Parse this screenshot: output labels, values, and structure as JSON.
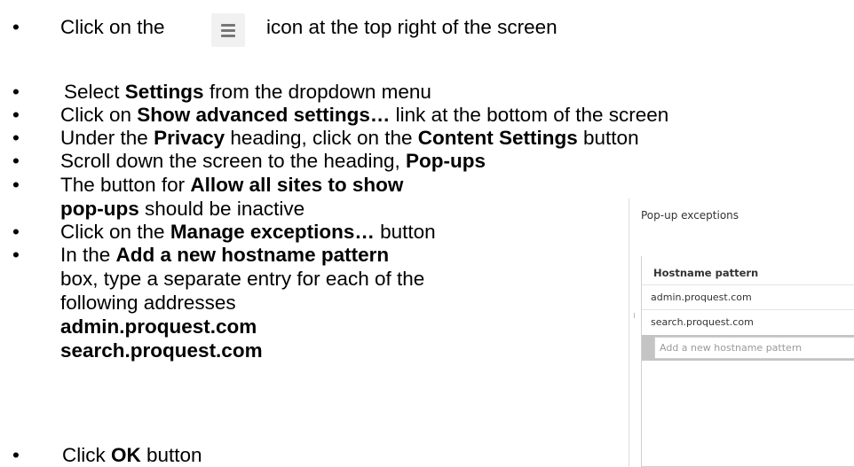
{
  "instructions": {
    "bullet": "•",
    "step1": {
      "before": "Click on the",
      "icon": "hamburger-menu-icon",
      "after": "icon at the top right of the screen"
    },
    "step2": {
      "pre": "Select ",
      "bold": "Settings",
      "post": " from the dropdown menu"
    },
    "step3": {
      "pre": "Click on ",
      "bold": "Show advanced settings…",
      "post": " link at the bottom of the screen"
    },
    "step4": {
      "pre": "Under the ",
      "bold1": "Privacy",
      "mid": " heading, click on the ",
      "bold2": "Content Settings",
      "post": " button"
    },
    "step5": {
      "pre": "Scroll down the screen to the heading, ",
      "bold": "Pop-ups"
    },
    "step6": {
      "pre": "The button for ",
      "bold": "Allow all sites to show pop-ups",
      "post": " should be inactive"
    },
    "step7": {
      "pre": "Click on the ",
      "bold": "Manage exceptions…",
      "post": " button"
    },
    "step8": {
      "pre": "In the ",
      "bold": "Add a new hostname pattern",
      "post": " box, type a separate entry for each of the following addresses"
    },
    "addresses": [
      "admin.proquest.com",
      "search.proquest.com"
    ],
    "step9": {
      "pre": "Click ",
      "bold": "OK",
      "post": " button"
    }
  },
  "dialog": {
    "title": "Pop-up exceptions",
    "column_header": "Hostname pattern",
    "rows": [
      "admin.proquest.com",
      "search.proquest.com"
    ],
    "new_pattern_placeholder": "Add a new hostname pattern"
  }
}
